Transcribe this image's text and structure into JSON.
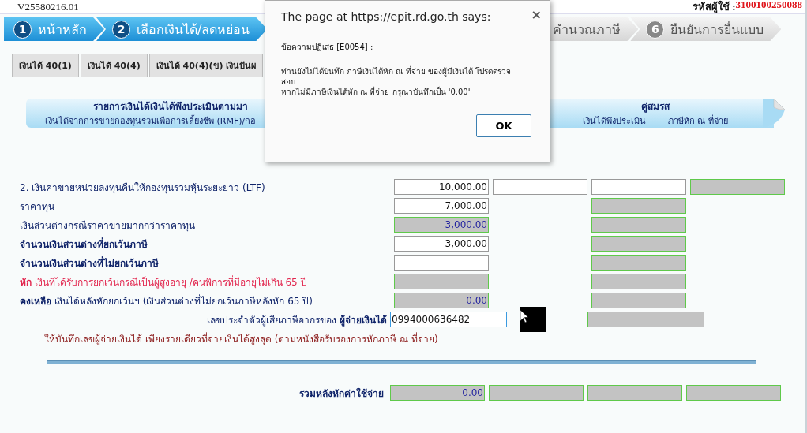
{
  "header": {
    "version": "V25580216.01",
    "user_label": "รหัสผู้ใช้ :",
    "user_id": "3100100250088"
  },
  "steps": [
    {
      "number": "1",
      "label": "หน้าหลัก",
      "active": true
    },
    {
      "number": "2",
      "label": "เลือกเงินได้/ลดหย่อน",
      "active": true
    },
    {
      "label": "คำนวณภาษี",
      "active": false
    },
    {
      "number": "6",
      "label": "ยืนยันการยื่นแบบ",
      "active": false
    }
  ],
  "tabs": [
    {
      "label": "เงินได้ 40(1)"
    },
    {
      "label": "เงินได้ 40(4)"
    },
    {
      "label": "เงินได้ 40(4)(ข) เงินปันผ"
    }
  ],
  "banner": {
    "title": "รายการเงินได้เงินได้พึงประเมินตามมา",
    "subtitle": "เงินได้จากการขายกองทุนรวมเพื่อการเลี้ยงชีพ (RMF)/กอ",
    "spouse_title": "คู่สมรส",
    "spouse_columns": [
      "เงินได้พึงประเมิน",
      "ภาษีหัก ณ ที่จ่าย"
    ]
  },
  "rows": [
    {
      "kind": "amounts",
      "label": "2. เงินค่าขายหน่วยลงทุนคืนให้กองทุนรวมหุ้นระยะยาว (LTF)",
      "bold": false,
      "warning": false,
      "cells": [
        {
          "kind": "input",
          "value": "10,000.00"
        },
        {
          "kind": "input"
        },
        {
          "kind": "input"
        },
        {
          "kind": "readonly"
        }
      ]
    },
    {
      "kind": "amounts",
      "label": "ราคาทุน",
      "bold": false,
      "warning": false,
      "cells": [
        {
          "kind": "input",
          "value": "7,000.00"
        },
        {
          "kind": "blank"
        },
        {
          "kind": "readonly"
        },
        {
          "kind": "blank"
        }
      ]
    },
    {
      "kind": "amounts",
      "label": "เงินส่วนต่างกรณีราคาขายมากกว่าราคาทุน",
      "bold": false,
      "warning": false,
      "cells": [
        {
          "kind": "readonly",
          "value": "3,000.00"
        },
        {
          "kind": "blank"
        },
        {
          "kind": "readonly"
        },
        {
          "kind": "blank"
        }
      ]
    },
    {
      "kind": "amounts",
      "label": "จำนวนเงินส่วนต่างที่ยกเว้นภาษี",
      "bold": true,
      "warning": false,
      "cells": [
        {
          "kind": "input",
          "value": "3,000.00"
        },
        {
          "kind": "blank"
        },
        {
          "kind": "readonly"
        },
        {
          "kind": "blank"
        }
      ]
    },
    {
      "kind": "amounts",
      "label": "จำนวนเงินส่วนต่างที่ไม่ยกเว้นภาษี",
      "bold": true,
      "warning": false,
      "cells": [
        {
          "kind": "input"
        },
        {
          "kind": "blank"
        },
        {
          "kind": "readonly"
        },
        {
          "kind": "blank"
        }
      ]
    },
    {
      "kind": "amounts",
      "label": "**หัก** เงินที่ได้รับการยกเว้นกรณีเป็นผู้สูงอายุ /คนพิการที่มีอายุไม่เกิน 65 ปี",
      "bold": false,
      "warning": true,
      "cells": [
        {
          "kind": "readonly"
        },
        {
          "kind": "blank"
        },
        {
          "kind": "readonly"
        },
        {
          "kind": "blank"
        }
      ]
    },
    {
      "kind": "amounts",
      "label": "**คงเหลือ** เงินได้หลังหักยกเว้นฯ (เงินส่วนต่างที่ไม่ยกเว้นภาษีหลังหัก 65 ปี)",
      "bold": false,
      "warning": false,
      "cells": [
        {
          "kind": "readonly",
          "value": "0.00"
        },
        {
          "kind": "blank"
        },
        {
          "kind": "readonly"
        },
        {
          "kind": "blank"
        }
      ]
    },
    {
      "kind": "payer",
      "label": "เลขประจำตัวผู้เสียภาษีอากรของ **ผู้จ่ายเงินได้**",
      "value": "0994000636482"
    },
    {
      "kind": "note",
      "label": "ให้บันทึกเลขผู้จ่ายเงินได้ เพียงรายเดียวที่จ่ายเงินได้สูงสุด (ตามหนังสือรับรองการหักภาษี ณ ที่จ่าย)"
    }
  ],
  "total": {
    "label": "รวมหลังหักค่าใช้จ่าย",
    "cells": [
      {
        "kind": "readonly",
        "value": "0.00"
      },
      {
        "kind": "readonly"
      },
      {
        "kind": "readonly"
      },
      {
        "kind": "readonly"
      }
    ]
  },
  "dialog": {
    "title": "The page at https://epit.rd.go.th says:",
    "close": "×",
    "heading": "ข้อความปฏิเสธ [E0054] :",
    "lines": [
      "ท่านยังไม่ได้บันทึก ภาษีเงินได้หัก ณ ที่จ่าย ของผู้มีเงินได้ โปรดตรวจสอบ",
      "หากไม่มีภาษีเงินได้หัก ณ ที่จ่าย กรุณาบันทึกเป็น '0.00'"
    ],
    "button": "OK"
  }
}
